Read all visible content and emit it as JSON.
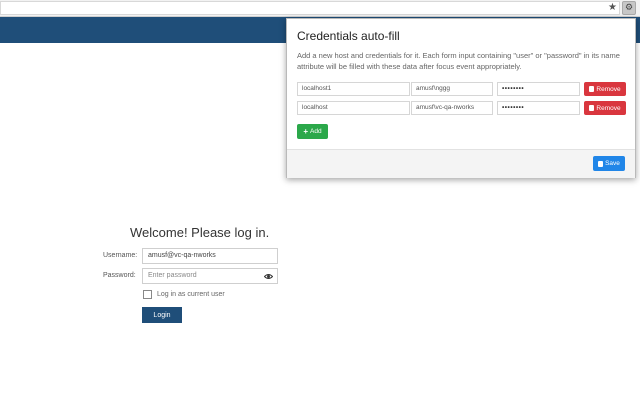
{
  "browser": {
    "address": "",
    "star_glyph": "★",
    "extension_glyph": "⚙"
  },
  "login": {
    "title": "Welcome! Please log in.",
    "username_label": "Username:",
    "username_value": "amusf@vc-qa-nworks",
    "password_label": "Password:",
    "password_placeholder": "Enter password",
    "checkbox_label": "Log in as current user",
    "login_button": "Login"
  },
  "popup": {
    "title": "Credentials auto-fill",
    "description": "Add a new host and credentials for it. Each form input containing \"user\" or \"password\" in its name attribute will be filled with these data after focus event appropriately.",
    "rows": [
      {
        "host": "localhost1",
        "user": "amusf\\nggg",
        "password": "••••••••",
        "remove_label": "Remove"
      },
      {
        "host": "localhost",
        "user": "amusf\\vc-qa-nworks",
        "password": "••••••••",
        "remove_label": "Remove"
      }
    ],
    "add_label": "Add",
    "save_label": "Save"
  },
  "colors": {
    "header": "#1f4e79",
    "remove": "#d9363e",
    "add": "#2ba84a",
    "save": "#2186e8"
  }
}
